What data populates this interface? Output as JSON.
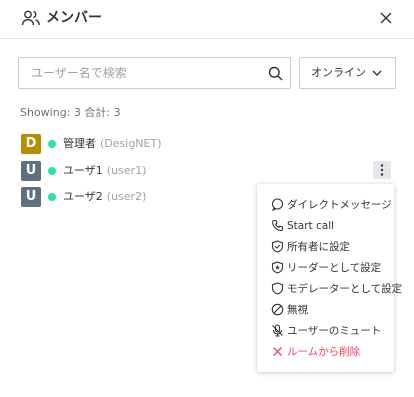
{
  "header": {
    "title": "メンバー"
  },
  "search": {
    "placeholder": "ユーザー名で検索"
  },
  "status_filter": {
    "value": "オンライン"
  },
  "summary": {
    "text": "Showing: 3  合計: 3"
  },
  "members": [
    {
      "initial": "D",
      "avatar_color": "#b68d00",
      "name": "管理者",
      "username": "(DesigNET)"
    },
    {
      "initial": "U",
      "avatar_color": "#607080",
      "name": "ユーザ1",
      "username": "(user1)"
    },
    {
      "initial": "U",
      "avatar_color": "#607080",
      "name": "ユーザ2",
      "username": "(user2)"
    }
  ],
  "menu": {
    "items": [
      {
        "label": "ダイレクトメッセージ",
        "icon": "chat-bubble-icon"
      },
      {
        "label": "Start call",
        "icon": "phone-icon"
      },
      {
        "label": "所有者に設定",
        "icon": "shield-check-icon"
      },
      {
        "label": "リーダーとして設定",
        "icon": "shield-star-icon"
      },
      {
        "label": "モデレーターとして設定",
        "icon": "shield-icon"
      },
      {
        "label": "無視",
        "icon": "ban-icon"
      },
      {
        "label": "ユーザーのミュート",
        "icon": "mic-off-icon"
      },
      {
        "label": "ルームから削除",
        "icon": "close-icon"
      }
    ]
  },
  "colors": {
    "online": "#2de0a5",
    "danger": "#f5455c"
  }
}
